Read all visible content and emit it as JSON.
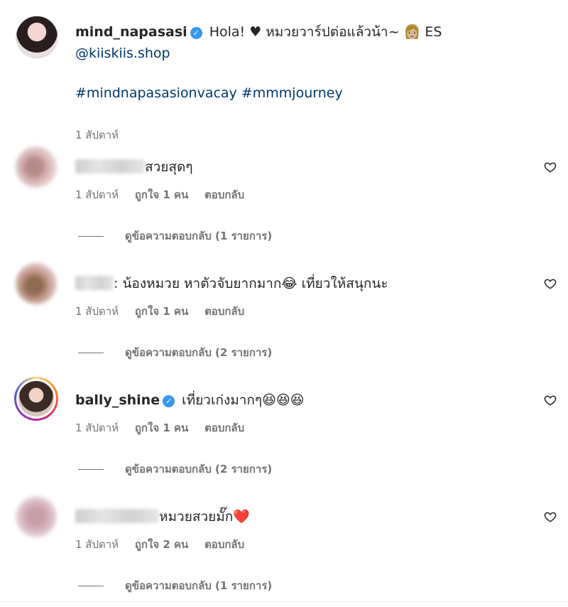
{
  "post": {
    "username": "mind_napasasi",
    "caption_text": "Hola! ♥ หมวยวาร์ปต่อแล้วน้า~ 👩🏼 ES",
    "mention": "@kiiskiis.shop",
    "hashtags": "#mindnapasasionvacay #mmmjourney",
    "time": "1 สัปดาห์"
  },
  "comments": [
    {
      "username": "",
      "text": "สวยสุดๆ",
      "time": "1 สัปดาห์",
      "likes": "ถูกใจ 1 คน",
      "reply": "ตอบกลับ",
      "view_replies": "ดูข้อความตอบกลับ (1 รายการ)"
    },
    {
      "username": "",
      "text": ": น้องหมวย หาตัวจับยากมาก😂 เที่ยวให้สนุกนะ",
      "time": "1 สัปดาห์",
      "likes": "ถูกใจ 1 คน",
      "reply": "ตอบกลับ",
      "view_replies": "ดูข้อความตอบกลับ (2 รายการ)"
    },
    {
      "username": "bally_shine",
      "text": "เที่ยวเก่งมากๆ😆😆😆",
      "time": "1 สัปดาห์",
      "likes": "ถูกใจ 1 คน",
      "reply": "ตอบกลับ",
      "view_replies": "ดูข้อความตอบกลับ (2 รายการ)"
    },
    {
      "username": "",
      "text": "หมวยสวยมั๊ก❤️",
      "time": "1 สัปดาห์",
      "likes": "ถูกใจ 2 คน",
      "reply": "ตอบกลับ",
      "view_replies": "ดูข้อความตอบกลับ (1 รายการ)"
    }
  ],
  "icons": {
    "verified": "verified-badge-icon",
    "heart": "heart-outline-icon"
  },
  "colors": {
    "link": "#00376b",
    "verified": "#3897f0",
    "muted": "#737373"
  }
}
